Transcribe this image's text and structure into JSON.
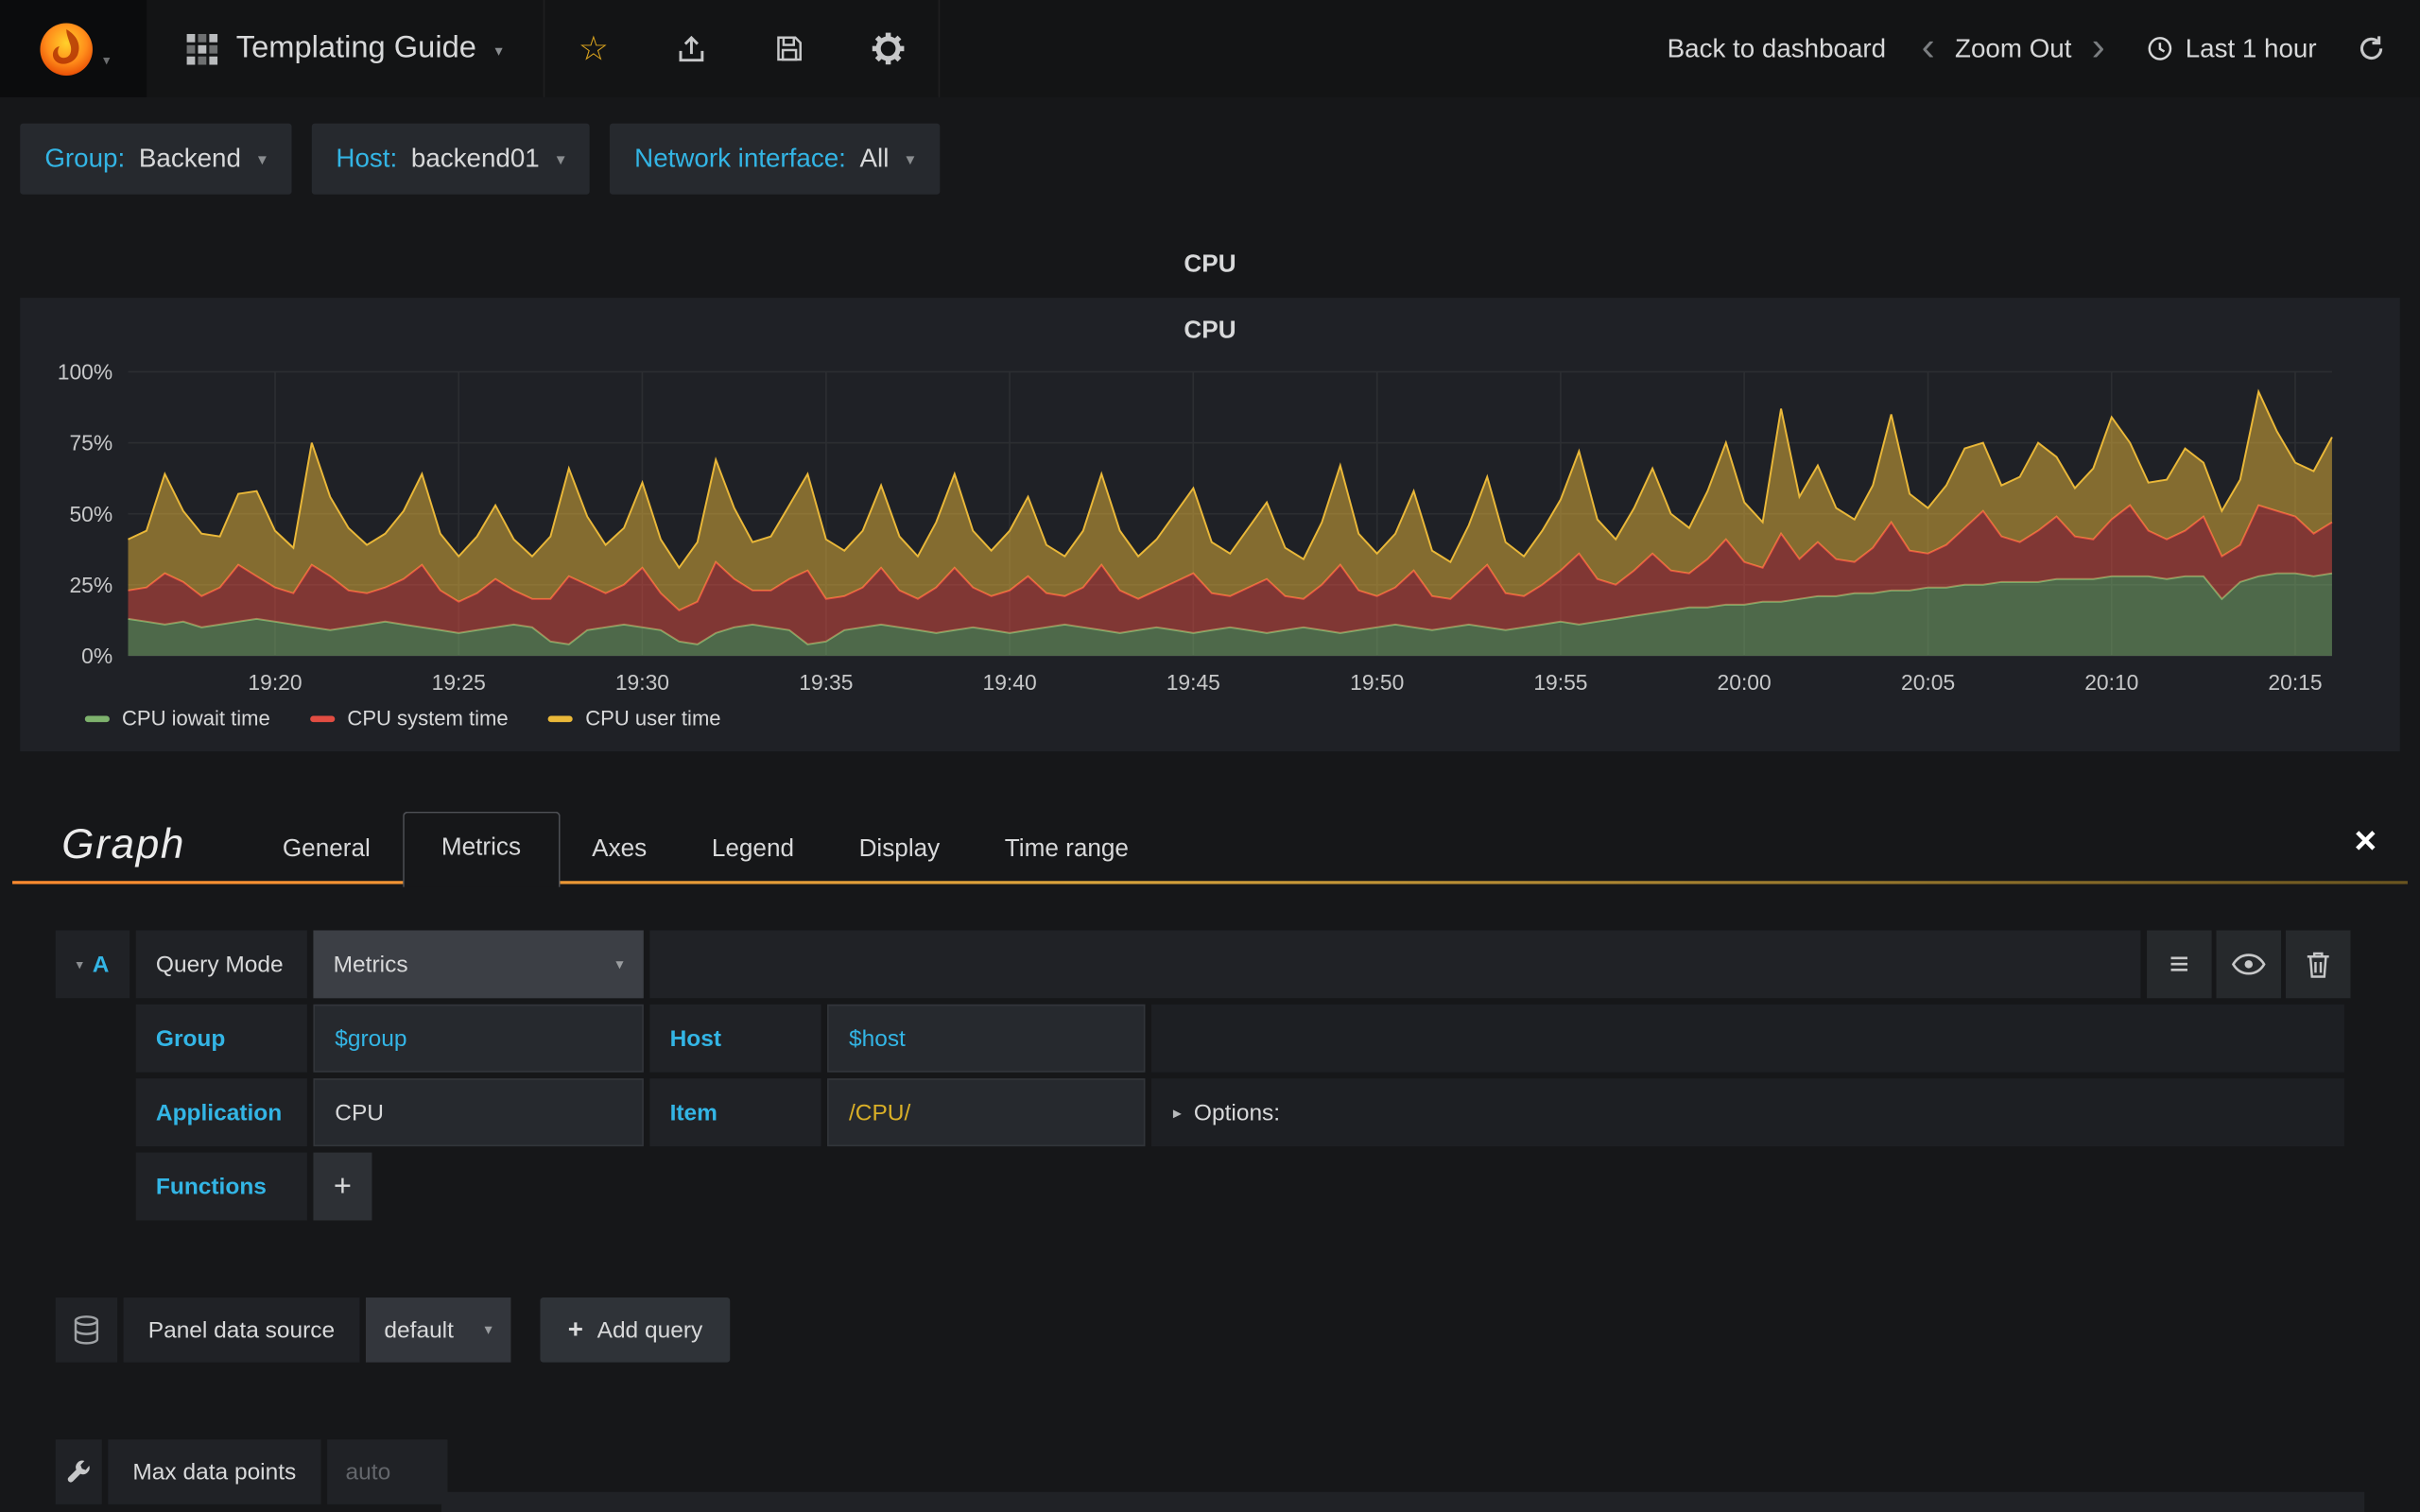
{
  "icons": {
    "caret_down": "▾",
    "caret_right": "▸",
    "chevron_left": "‹",
    "chevron_right": "›",
    "star": "☆",
    "menu": "≡",
    "plus": "+",
    "close": "×"
  },
  "navbar": {
    "title": "Templating Guide",
    "back_to_dashboard": "Back to dashboard",
    "zoom_out": "Zoom Out",
    "time_range": "Last 1 hour"
  },
  "variables": [
    {
      "label": "Group:",
      "value": "Backend"
    },
    {
      "label": "Host:",
      "value": "backend01"
    },
    {
      "label": "Network interface:",
      "value": "All"
    }
  ],
  "panel": {
    "title": "CPU",
    "graph_title": "CPU"
  },
  "chart_data": {
    "type": "area",
    "stacked": true,
    "title": "CPU",
    "xlabel": "",
    "ylabel": "",
    "ylim": [
      0,
      100
    ],
    "grid": true,
    "legend_position": "bottom-left",
    "y_ticks": [
      "0%",
      "25%",
      "50%",
      "75%",
      "100%"
    ],
    "x_ticks": [
      {
        "label": "19:20",
        "f": 0.0667
      },
      {
        "label": "19:25",
        "f": 0.15
      },
      {
        "label": "19:30",
        "f": 0.2333
      },
      {
        "label": "19:35",
        "f": 0.3167
      },
      {
        "label": "19:40",
        "f": 0.4
      },
      {
        "label": "19:45",
        "f": 0.4833
      },
      {
        "label": "19:50",
        "f": 0.5667
      },
      {
        "label": "19:55",
        "f": 0.65
      },
      {
        "label": "20:00",
        "f": 0.7333
      },
      {
        "label": "20:05",
        "f": 0.8167
      },
      {
        "label": "20:10",
        "f": 0.9
      },
      {
        "label": "20:15",
        "f": 0.9833
      }
    ],
    "series": [
      {
        "name": "CPU iowait time",
        "color": "#7eb26d",
        "values": [
          13,
          12,
          11,
          12,
          10,
          11,
          12,
          13,
          12,
          11,
          10,
          9,
          10,
          11,
          12,
          11,
          10,
          9,
          8,
          9,
          10,
          11,
          10,
          5,
          4,
          9,
          10,
          11,
          10,
          9,
          5,
          4,
          8,
          10,
          11,
          10,
          9,
          4,
          5,
          9,
          10,
          11,
          10,
          9,
          8,
          9,
          10,
          9,
          8,
          9,
          10,
          11,
          10,
          9,
          8,
          9,
          10,
          9,
          8,
          9,
          10,
          9,
          8,
          9,
          10,
          9,
          8,
          9,
          10,
          11,
          10,
          9,
          10,
          11,
          10,
          9,
          10,
          11,
          12,
          11,
          12,
          13,
          14,
          15,
          16,
          17,
          17,
          18,
          18,
          19,
          19,
          20,
          21,
          21,
          22,
          22,
          23,
          23,
          24,
          24,
          25,
          25,
          26,
          26,
          26,
          27,
          27,
          27,
          28,
          28,
          28,
          27,
          28,
          28,
          20,
          26,
          28,
          29,
          29,
          28,
          29
        ]
      },
      {
        "name": "CPU system time",
        "color": "#e24d42",
        "values": [
          10,
          12,
          18,
          14,
          11,
          13,
          20,
          15,
          12,
          11,
          22,
          19,
          13,
          11,
          12,
          16,
          22,
          14,
          11,
          13,
          17,
          12,
          10,
          15,
          24,
          16,
          12,
          14,
          21,
          13,
          11,
          15,
          25,
          17,
          12,
          13,
          18,
          26,
          15,
          12,
          14,
          20,
          13,
          11,
          16,
          22,
          14,
          12,
          15,
          19,
          12,
          10,
          14,
          23,
          15,
          11,
          13,
          17,
          21,
          13,
          11,
          15,
          19,
          12,
          10,
          16,
          24,
          14,
          11,
          13,
          20,
          12,
          10,
          15,
          22,
          13,
          11,
          14,
          18,
          25,
          15,
          12,
          16,
          21,
          14,
          12,
          17,
          23,
          15,
          12,
          24,
          14,
          19,
          13,
          11,
          16,
          24,
          14,
          12,
          15,
          20,
          26,
          16,
          14,
          18,
          22,
          15,
          14,
          20,
          25,
          16,
          14,
          16,
          21,
          15,
          13,
          25,
          22,
          20,
          15,
          18
        ]
      },
      {
        "name": "CPU user time",
        "color": "#eab839",
        "values": [
          18,
          20,
          35,
          25,
          22,
          18,
          25,
          30,
          20,
          16,
          43,
          28,
          22,
          17,
          19,
          24,
          32,
          20,
          16,
          20,
          26,
          18,
          15,
          22,
          38,
          24,
          17,
          20,
          30,
          19,
          15,
          21,
          36,
          25,
          17,
          19,
          26,
          34,
          21,
          16,
          20,
          29,
          19,
          15,
          23,
          33,
          20,
          16,
          21,
          28,
          17,
          14,
          20,
          32,
          21,
          15,
          18,
          24,
          30,
          18,
          15,
          21,
          27,
          17,
          14,
          22,
          35,
          20,
          15,
          19,
          28,
          16,
          13,
          20,
          31,
          18,
          14,
          19,
          25,
          36,
          21,
          16,
          22,
          30,
          20,
          16,
          24,
          34,
          21,
          16,
          44,
          22,
          27,
          18,
          15,
          22,
          38,
          20,
          16,
          21,
          28,
          24,
          18,
          23,
          31,
          21,
          17,
          25,
          36,
          22,
          17,
          21,
          29,
          19,
          16,
          23,
          40,
          28,
          19,
          22,
          30
        ]
      }
    ]
  },
  "editor": {
    "panel_type": "Graph",
    "tabs": [
      "General",
      "Metrics",
      "Axes",
      "Legend",
      "Display",
      "Time range"
    ],
    "active_tab": "Metrics",
    "query": {
      "letter": "A",
      "query_mode_label": "Query Mode",
      "query_mode_value": "Metrics",
      "group_label": "Group",
      "group_value": "$group",
      "host_label": "Host",
      "host_value": "$host",
      "application_label": "Application",
      "application_value": "CPU",
      "item_label": "Item",
      "item_value": "/CPU/",
      "options_label": "Options:",
      "functions_label": "Functions",
      "add_function_label": "+"
    },
    "datasource": {
      "label": "Panel data source",
      "value": "default",
      "add_query_label": "Add query"
    },
    "max_data_points": {
      "label": "Max data points",
      "placeholder": "auto"
    }
  }
}
